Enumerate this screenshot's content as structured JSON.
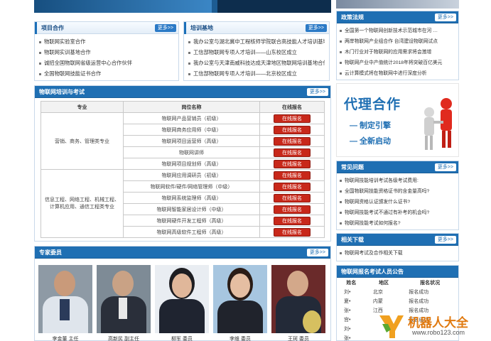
{
  "banner": {
    "brand_colors": [
      "#1d5c92",
      "#6fbf3f"
    ]
  },
  "project": {
    "title": "项目合作",
    "more": "更多>>",
    "items": [
      "物联网实验室合作",
      "物联网实训基地合作",
      "诚招全国物联网省级运营中心合作伙伴",
      "全国物联网技能证书合作"
    ]
  },
  "training_base": {
    "title": "培训基地",
    "more": "更多>>",
    "items": [
      "我办公室与湖北冀中工程核师学院联合高技能人才培训基地签约",
      "工信部物联网专项人才培训——山东校区成立",
      "我办公室与天津南威科技达成天津地区物联网培训基地合作协议",
      "工信部物联网专项人才培训——北京校区成立"
    ]
  },
  "news": {
    "title": "政策法规",
    "more": "更多>>",
    "items": [
      "全国第一个物联网创新技术示范城市在河 …",
      "两岸物联网产业组合作 台湾建设物联网试点",
      "木门行业对于物联网的应用需求将会激增",
      "物联网产业中产值统计2018年将突破百亿美元",
      "云计算模式将在物联网中进行深度分析"
    ]
  },
  "training": {
    "title": "物联网培训与考试",
    "more": "更多>>",
    "headers": [
      "专业",
      "岗位名称",
      "在线报名"
    ],
    "groups": [
      {
        "major": "营销、商务、管理类专业",
        "positions": [
          "物联网产品营销员（初级）",
          "物联网商务应用师（中级）",
          "物联网项目运营师（高级）",
          "物联网讲师",
          "物联网项目规划师（高级）"
        ]
      },
      {
        "major": "信息工程、网络工程、机械工程、计算机应用、通信工程类专业",
        "positions": [
          "物联网应用调研员（初级）",
          "物联网软件/硬件/网络管理师（中级）",
          "物联网系统监理师（高级）",
          "物联网智能家居设计师（中级）",
          "物联网硬件开发工程师（高级）",
          "物联网高级软件工程师（高级）"
        ]
      }
    ],
    "register_label": "在线报名"
  },
  "experts": {
    "title": "专家委员",
    "more": "更多>>",
    "people": [
      "李金董 主任",
      "高新民 副主任",
      "柳军 委员",
      "李维 委员",
      "王珂 委员"
    ]
  },
  "ad": {
    "title": "代理合作",
    "line1": "— 制定引擎",
    "line2": "— 全新启动"
  },
  "faq": {
    "title": "常见问题",
    "more": "更多>>",
    "items": [
      "物联网技能培训考试各级考试费用:",
      "全国物联网技能资格证书的含金量高吗?",
      "物联网资格认证颁发什么证书?",
      "物联网技能考试不通过有补考的机会吗?",
      "物联网技能考试如何报名?"
    ]
  },
  "related": {
    "title": "相关下载",
    "more": "更多>>",
    "items": [
      "物联网考试及合作相关下载"
    ]
  },
  "report": {
    "title": "物联网报名考试人员公告",
    "headers": [
      "姓名",
      "地区",
      "报名状况"
    ],
    "rows": [
      [
        "刘•",
        "北京",
        "报名成功"
      ],
      [
        "夏•",
        "内蒙",
        "报名成功"
      ],
      [
        "张•",
        "江西",
        "报名成功"
      ],
      [
        "宫•",
        "",
        "报名成功"
      ],
      [
        "刘•",
        "",
        ""
      ],
      [
        "张•",
        "",
        ""
      ]
    ]
  },
  "watermark": {
    "brand": "机器人大全",
    "url": "www.robo123.com"
  }
}
